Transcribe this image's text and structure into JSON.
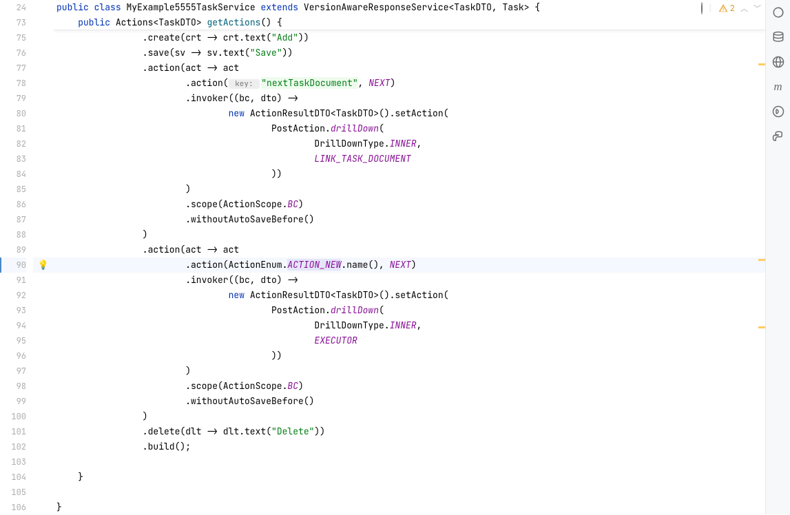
{
  "sticky": {
    "line1_num": "24",
    "line2_num": "73",
    "classDecl": {
      "public": "public",
      "class": "class",
      "name": "MyExample5555TaskService",
      "extends": "extends",
      "parent": "VersionAwareResponseService",
      "generic": "<TaskDTO, Task> {"
    },
    "methodDecl": {
      "public": "public",
      "returnType": "Actions<TaskDTO>",
      "name": "getActions",
      "tail": "() {"
    }
  },
  "gutter": [
    "75",
    "76",
    "77",
    "78",
    "79",
    "80",
    "81",
    "82",
    "83",
    "84",
    "85",
    "86",
    "87",
    "88",
    "89",
    "90",
    "91",
    "92",
    "93",
    "94",
    "95",
    "96",
    "97",
    "98",
    "99",
    "100",
    "101",
    "102",
    "103",
    "104",
    "105",
    "106"
  ],
  "code": {
    "l75": {
      "prefix": "                .create(crt -> crt.text(",
      "str": "\"Add\"",
      "suffix": "))"
    },
    "l76": {
      "prefix": "                .save(sv -> sv.text(",
      "str": "\"Save\"",
      "suffix": "))"
    },
    "l77": "                .action(act -> act",
    "l78": {
      "indent": "                        .action(",
      "hint": " key: ",
      "str": "\"nextTaskDocument\"",
      "mid": ", ",
      "const": "NEXT",
      "suffix": ")"
    },
    "l79": "                        .invoker((bc, dto) ->",
    "l80": {
      "indent": "                                ",
      "new": "new",
      "tail": " ActionResultDTO<TaskDTO>().setAction("
    },
    "l81": {
      "indent": "                                        PostAction.",
      "method": "drillDown",
      "tail": "("
    },
    "l82": {
      "indent": "                                                DrillDownType.",
      "const": "INNER",
      "tail": ","
    },
    "l83": {
      "indent": "                                                ",
      "const": "LINK_TASK_DOCUMENT"
    },
    "l84": "                                        ))",
    "l85": "                        )",
    "l86": {
      "indent": "                        .scope(ActionScope.",
      "const": "BC",
      "tail": ")"
    },
    "l87": "                        .withoutAutoSaveBefore()",
    "l88": "                )",
    "l89": "                .action(act -> act",
    "l90": {
      "indent": "                        .action(ActionEnum.",
      "enum": "ACTION_NEW",
      "mid": ".name(), ",
      "const": "NEXT",
      "tail": ")"
    },
    "l91": "                        .invoker((bc, dto) ->",
    "l92": {
      "indent": "                                ",
      "new": "new",
      "tail": " ActionResultDTO<TaskDTO>().setAction("
    },
    "l93": {
      "indent": "                                        PostAction.",
      "method": "drillDown",
      "tail": "("
    },
    "l94": {
      "indent": "                                                DrillDownType.",
      "const": "INNER",
      "tail": ","
    },
    "l95": {
      "indent": "                                                ",
      "const": "EXECUTOR"
    },
    "l96": "                                        ))",
    "l97": "                        )",
    "l98": {
      "indent": "                        .scope(ActionScope.",
      "const": "BC",
      "tail": ")"
    },
    "l99": "                        .withoutAutoSaveBefore()",
    "l100": "                )",
    "l101": {
      "prefix": "                .delete(dlt -> dlt.text(",
      "str": "\"Delete\"",
      "suffix": "))"
    },
    "l102": "                .build();",
    "l103": "",
    "l104": "    }",
    "l105": "",
    "l106": "}"
  },
  "warnings": {
    "count": "2"
  },
  "icons": {
    "bulb": "💡"
  }
}
